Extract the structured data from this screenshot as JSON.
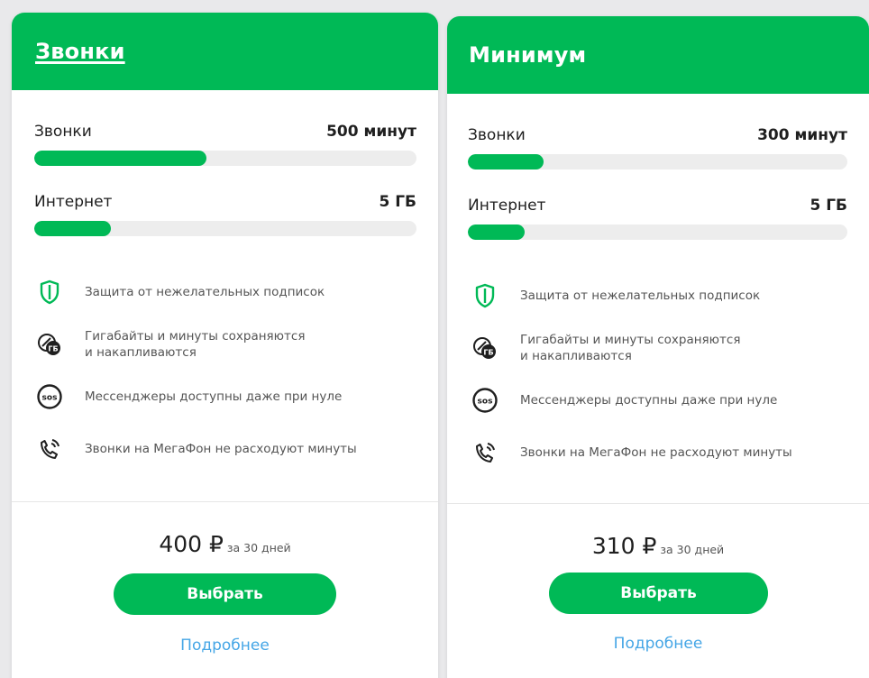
{
  "theme": {
    "accent": "#00b956",
    "link": "#45a6e6",
    "bar_track": "#ededed"
  },
  "cards": [
    {
      "title": "Звонки",
      "title_is_link": true,
      "quotas": [
        {
          "label": "Звонки",
          "value": "500 минут",
          "fill": 0.45
        },
        {
          "label": "Интернет",
          "value": "5 ГБ",
          "fill": 0.2
        }
      ],
      "features": [
        {
          "icon": "shield-icon",
          "text": "Защита от нежелательных подписок"
        },
        {
          "icon": "gb-rollover-icon",
          "text": "Гигабайты и минуты сохраняются\nи накапливаются"
        },
        {
          "icon": "sos-icon",
          "text": "Мессенджеры доступны даже при нуле"
        },
        {
          "icon": "phone-call-icon",
          "text": "Звонки на МегаФон не расходуют минуты"
        }
      ],
      "price": "400 ₽",
      "period": "за 30 дней",
      "choose_label": "Выбрать",
      "more_label": "Подробнее"
    },
    {
      "title": "Минимум",
      "title_is_link": false,
      "quotas": [
        {
          "label": "Звонки",
          "value": "300 минут",
          "fill": 0.2
        },
        {
          "label": "Интернет",
          "value": "5 ГБ",
          "fill": 0.15
        }
      ],
      "features": [
        {
          "icon": "shield-icon",
          "text": "Защита от нежелательных подписок"
        },
        {
          "icon": "gb-rollover-icon",
          "text": "Гигабайты и минуты сохраняются\nи накапливаются"
        },
        {
          "icon": "sos-icon",
          "text": "Мессенджеры доступны даже при нуле"
        },
        {
          "icon": "phone-call-icon",
          "text": "Звонки на МегаФон не расходуют минуты"
        }
      ],
      "price": "310 ₽",
      "period": "за 30 дней",
      "choose_label": "Выбрать",
      "more_label": "Подробнее"
    }
  ]
}
